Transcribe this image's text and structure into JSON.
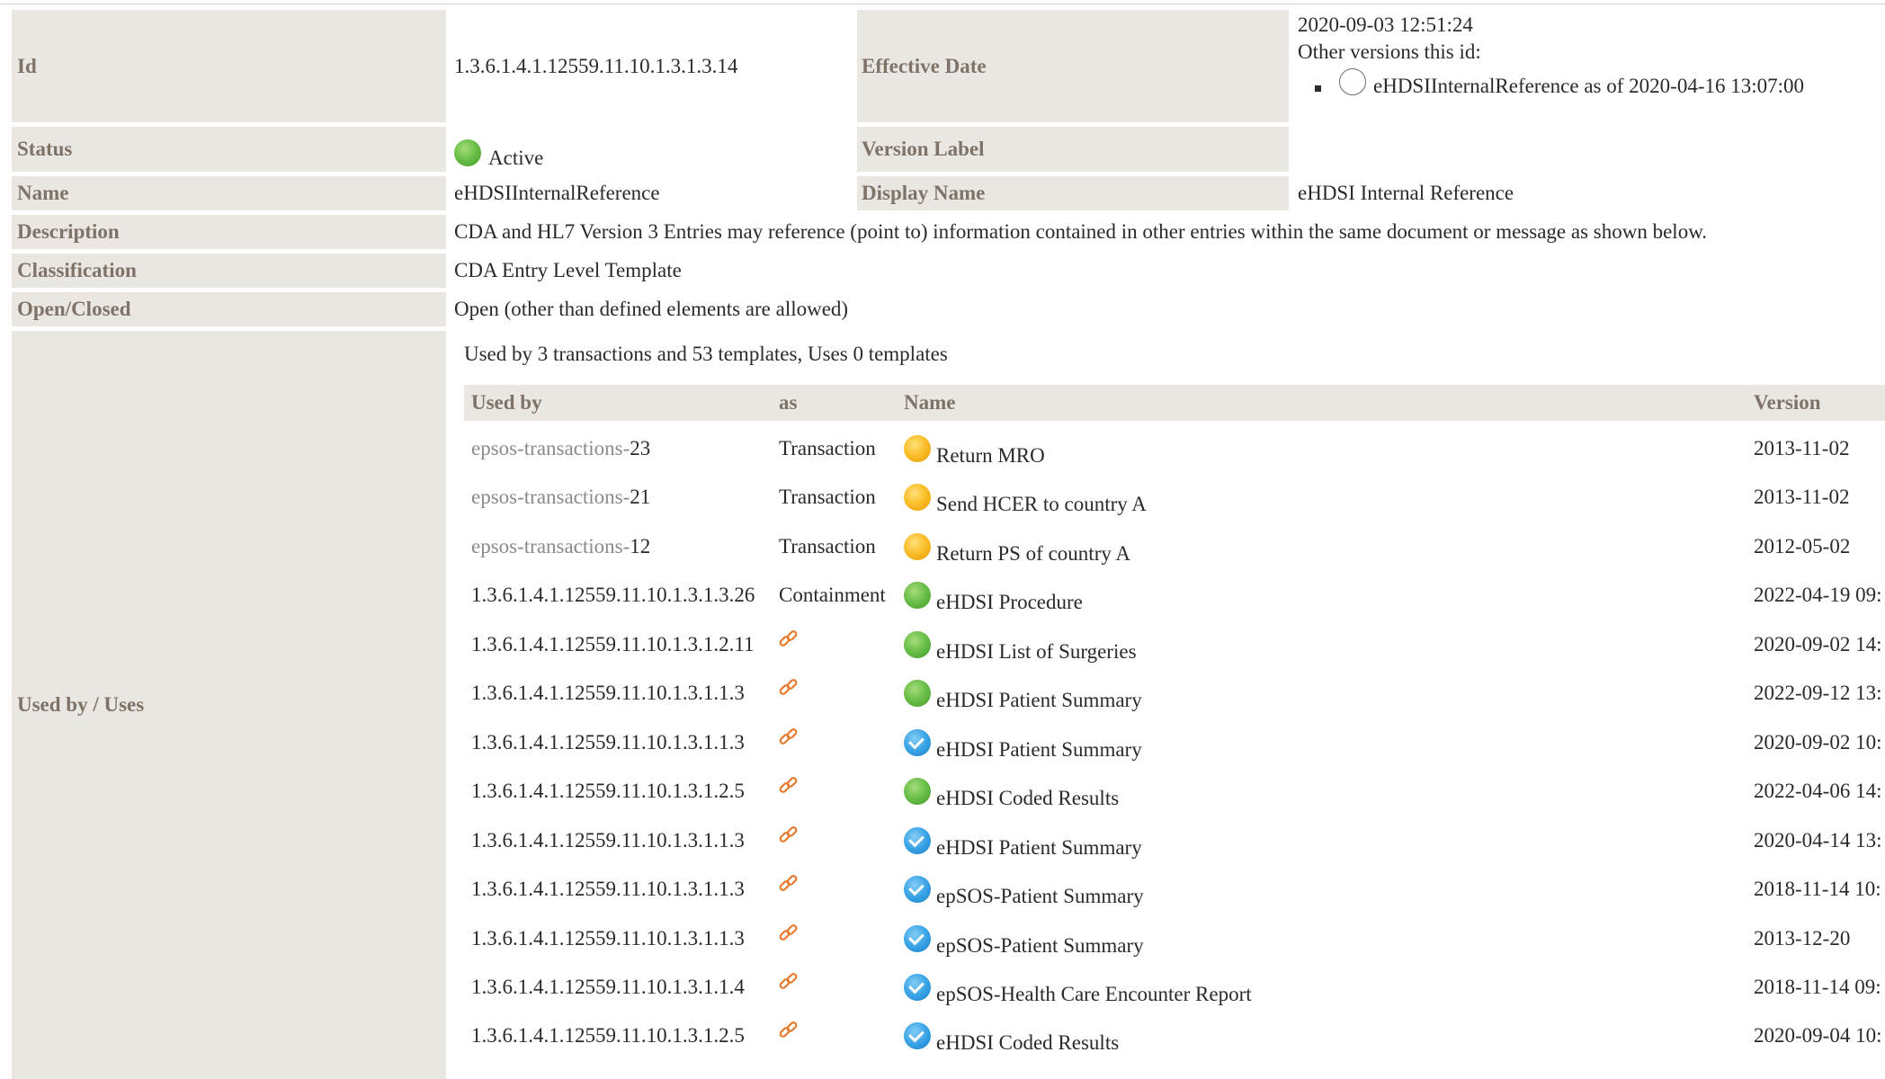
{
  "template": {
    "id_label": "Id",
    "id_value": "1.3.6.1.4.1.12559.11.10.1.3.1.3.14",
    "effective_date_label": "Effective Date",
    "effective_date_value": "2020-09-03 12:51:24",
    "other_versions_label": "Other versions this id:",
    "other_versions": [
      {
        "text": "eHDSIInternalReference as of 2020-04-16 13:07:00",
        "icon": "hollow-circle-icon"
      }
    ],
    "status_label": "Status",
    "status_value": "Active",
    "status_color": "#6cc04a",
    "version_label_label": "Version Label",
    "version_label_value": "",
    "name_label": "Name",
    "name_value": "eHDSIInternalReference",
    "display_name_label": "Display Name",
    "display_name_value": "eHDSI Internal Reference",
    "description_label": "Description",
    "description_value": "CDA and HL7 Version 3 Entries may reference (point to) information contained in other entries within the same document or message as shown below.",
    "classification_label": "Classification",
    "classification_value": "CDA Entry Level Template",
    "open_closed_label": "Open/Closed",
    "open_closed_value": "Open (other than defined elements are allowed)",
    "used_by_uses_label": "Used by / Uses"
  },
  "usage": {
    "summary": "Used by 3 transactions and 53 templates, Uses 0 templates",
    "headers": {
      "used_by": "Used by",
      "as": "as",
      "name": "Name",
      "version": "Version"
    },
    "rows": [
      {
        "prefix": "epsos-transactions-",
        "id": "23",
        "as": "Transaction",
        "status_icon": "yellow-circle-icon",
        "name": "Return MRO",
        "version": "2013-11-02"
      },
      {
        "prefix": "epsos-transactions-",
        "id": "21",
        "as": "Transaction",
        "status_icon": "yellow-circle-icon",
        "name": "Send HCER to country A",
        "version": "2013-11-02"
      },
      {
        "prefix": "epsos-transactions-",
        "id": "12",
        "as": "Transaction",
        "status_icon": "yellow-circle-icon",
        "name": "Return PS of country A",
        "version": "2012-05-02"
      },
      {
        "prefix": "",
        "id": "1.3.6.1.4.1.12559.11.10.1.3.1.3.26",
        "as": "Containment",
        "status_icon": "green-circle-icon",
        "name": "eHDSI Procedure",
        "version": "2022-04-19 09:"
      },
      {
        "prefix": "",
        "id": "1.3.6.1.4.1.12559.11.10.1.3.1.2.11",
        "as": "link-icon",
        "status_icon": "green-circle-icon",
        "name": "eHDSI List of Surgeries",
        "version": "2020-09-02 14:"
      },
      {
        "prefix": "",
        "id": "1.3.6.1.4.1.12559.11.10.1.3.1.1.3",
        "as": "link-icon",
        "status_icon": "green-circle-icon",
        "name": "eHDSI Patient Summary",
        "version": "2022-09-12 13:"
      },
      {
        "prefix": "",
        "id": "1.3.6.1.4.1.12559.11.10.1.3.1.1.3",
        "as": "link-icon",
        "status_icon": "blue-check-icon",
        "name": "eHDSI Patient Summary",
        "version": "2020-09-02 10:"
      },
      {
        "prefix": "",
        "id": "1.3.6.1.4.1.12559.11.10.1.3.1.2.5",
        "as": "link-icon",
        "status_icon": "green-circle-icon",
        "name": "eHDSI Coded Results",
        "version": "2022-04-06 14:"
      },
      {
        "prefix": "",
        "id": "1.3.6.1.4.1.12559.11.10.1.3.1.1.3",
        "as": "link-icon",
        "status_icon": "blue-check-icon",
        "name": "eHDSI Patient Summary",
        "version": "2020-04-14 13:"
      },
      {
        "prefix": "",
        "id": "1.3.6.1.4.1.12559.11.10.1.3.1.1.3",
        "as": "link-icon",
        "status_icon": "blue-check-icon",
        "name": "epSOS-Patient Summary",
        "version": "2018-11-14 10:"
      },
      {
        "prefix": "",
        "id": "1.3.6.1.4.1.12559.11.10.1.3.1.1.3",
        "as": "link-icon",
        "status_icon": "blue-check-icon",
        "name": "epSOS-Patient Summary",
        "version": "2013-12-20"
      },
      {
        "prefix": "",
        "id": "1.3.6.1.4.1.12559.11.10.1.3.1.1.4",
        "as": "link-icon",
        "status_icon": "blue-check-icon",
        "name": "epSOS-Health Care Encounter Report",
        "version": "2018-11-14 09:"
      },
      {
        "prefix": "",
        "id": "1.3.6.1.4.1.12559.11.10.1.3.1.2.5",
        "as": "link-icon",
        "status_icon": "blue-check-icon",
        "name": "eHDSI Coded Results",
        "version": "2020-09-04 10:"
      }
    ]
  },
  "colors": {
    "label_bg": "#eae6e1",
    "label_text": "#7d7369",
    "link_icon": "#e8782a",
    "status_green": "#6cc04a",
    "status_yellow": "#fbbf2c",
    "status_blue": "#3aa4e6"
  }
}
